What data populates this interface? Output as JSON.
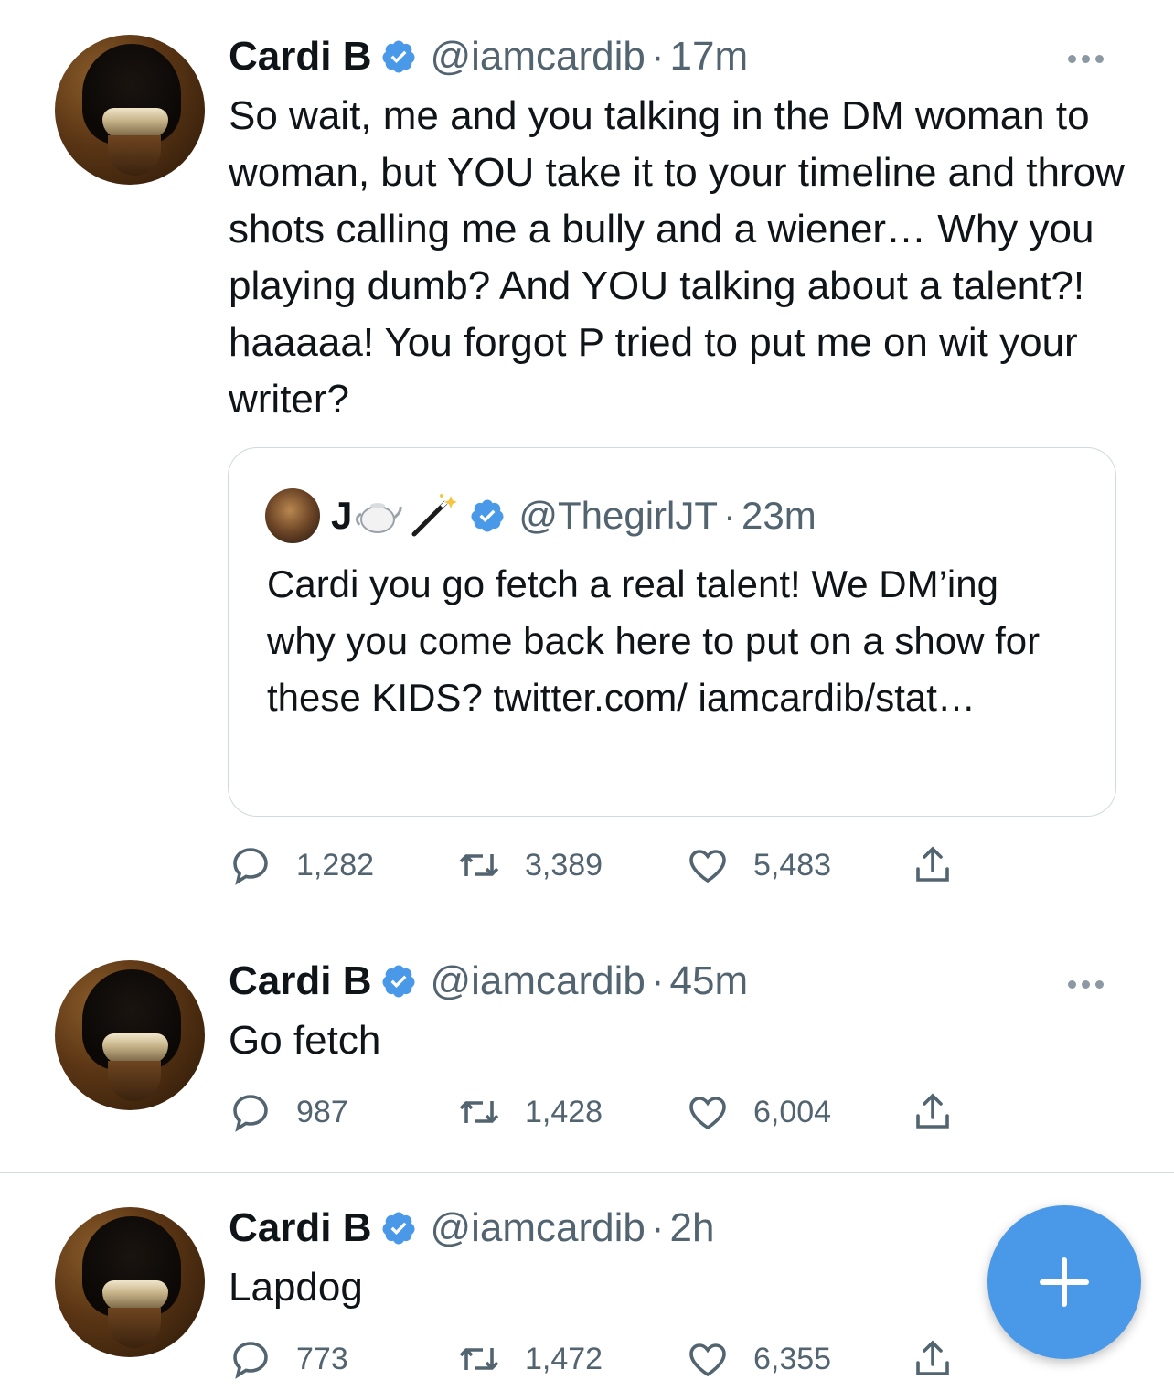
{
  "tweets": [
    {
      "name": "Cardi B",
      "handle": "@iamcardib",
      "separator": "·",
      "time": "17m",
      "text": "So wait, me and you talking in the DM woman to woman, but YOU take it to your timeline and throw shots calling me a bully and a wiener… Why you playing dumb? And YOU talking about a talent?! haaaaa! You forgot P tried to put me on wit your writer?",
      "quote": {
        "name": "J",
        "emoji": [
          "teapot-emoji",
          "magic-wand-emoji"
        ],
        "handle": "@ThegirlJT",
        "separator": "·",
        "time": "23m",
        "text": "Cardi you go fetch a real talent! We DM’ing why you come back here to put on a show for these KIDS? twitter.com/ iamcardib/stat…"
      },
      "replies": "1,282",
      "retweets": "3,389",
      "likes": "5,483"
    },
    {
      "name": "Cardi B",
      "handle": "@iamcardib",
      "separator": "·",
      "time": "45m",
      "text": "Go fetch",
      "replies": "987",
      "retweets": "1,428",
      "likes": "6,004"
    },
    {
      "name": "Cardi B",
      "handle": "@iamcardib",
      "separator": "·",
      "time": "2h",
      "text": "Lapdog",
      "replies": "773",
      "retweets": "1,472",
      "likes": "6,355"
    }
  ],
  "colors": {
    "accent": "#4a99e9",
    "muted": "#536471",
    "text": "#0f1419",
    "verified": "#4a99e9"
  },
  "icons": [
    "reply-icon",
    "retweet-icon",
    "like-icon",
    "share-icon",
    "verified-badge-icon",
    "more-icon",
    "compose-plus-icon"
  ]
}
